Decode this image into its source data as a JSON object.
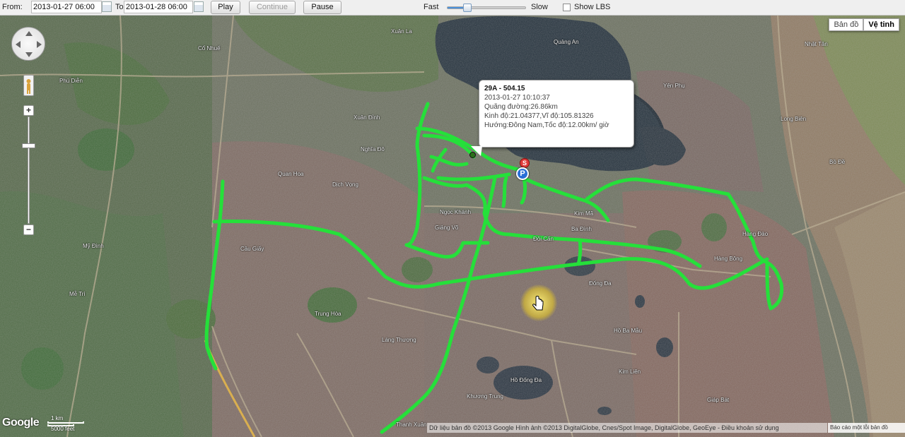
{
  "toolbar": {
    "from_label": "From:",
    "from_value": "2013-01-27 06:00",
    "to_label": "To",
    "to_value": "2013-01-28 06:00",
    "play_label": "Play",
    "continue_label": "Continue",
    "pause_label": "Pause",
    "fast_label": "Fast",
    "slow_label": "Slow",
    "speed_level": 0.22,
    "show_lbs_label": "Show LBS",
    "show_lbs_checked": false
  },
  "map_type": {
    "map_label": "Bản đồ",
    "satellite_label": "Vệ tinh",
    "active": "satellite"
  },
  "info_window": {
    "title": "29A - 504.15",
    "time": "2013-01-27 10:10:37",
    "distance": "Quãng đường:26.86km",
    "coords": "Kinh độ:21.04377,Vĩ độ:105.81326",
    "heading_speed": "Hướng:Đông Nam,Tốc độ:12.00km/ giờ"
  },
  "markers": {
    "start_label": "S",
    "parking_label": "P"
  },
  "map_labels": [
    "Xuân La",
    "Phú Diễn",
    "Cổ Nhuế",
    "Nghĩa Đô",
    "Quan Hoa",
    "Cầu Giấy",
    "Dịch Vọng",
    "Mỹ Đình",
    "Mễ Trì",
    "Ngọc Khánh",
    "Kim Mã",
    "Giảng Võ",
    "Đội Cấn",
    "Ba Đình",
    "Hàng Bông",
    "Hàng Đào",
    "Đống Đa",
    "Láng Thượng",
    "Quảng An",
    "Yên Phụ",
    "Nhật Tân",
    "Long Biên",
    "Bồ Đề",
    "Thanh Xuân",
    "Hồ Ba Mẫu",
    "Kim Liên",
    "Hồ Đống Đa",
    "Giáp Bát",
    "Xuân Đỉnh",
    "Khương Trung",
    "Trung Hòa"
  ],
  "route_color": "#25e03a",
  "footer": {
    "google": "Google",
    "scale_km": "1 km",
    "scale_ft": "5000 feet",
    "attribution": "Dữ liệu bản đồ ©2013 Google Hình ảnh ©2013 DigitalGlobe, Cnes/Spot Image, DigitalGlobe, GeoEye - Điều khoản sử dụng",
    "report": "Báo cáo một lỗi bản đồ"
  }
}
